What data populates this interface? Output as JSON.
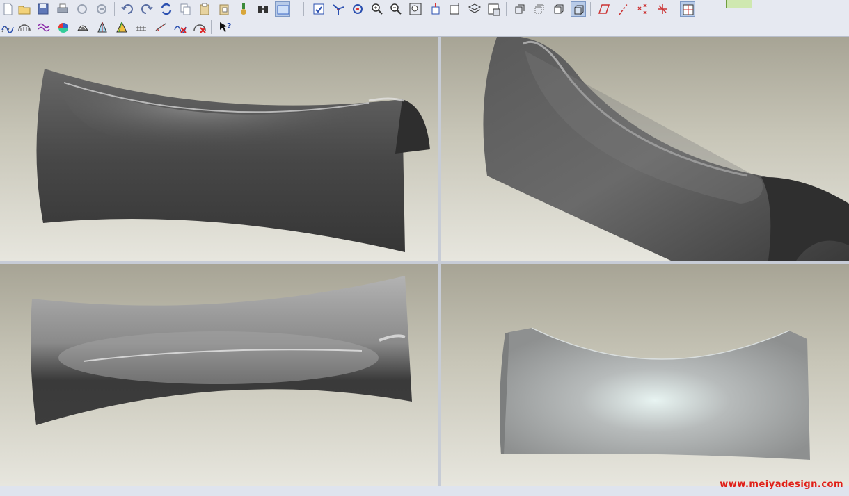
{
  "toolbar_top": {
    "tools": [
      {
        "name": "new-file-icon",
        "active": false
      },
      {
        "name": "open-folder-icon",
        "active": false
      },
      {
        "name": "save-icon",
        "active": false
      },
      {
        "name": "print-icon",
        "active": false
      },
      {
        "name": "send-mail-icon",
        "active": false
      },
      {
        "name": "send-link-icon",
        "active": false
      },
      {
        "name": "undo-icon",
        "active": false
      },
      {
        "name": "redo-icon",
        "active": false
      },
      {
        "name": "regenerate-icon",
        "active": false
      },
      {
        "name": "copy-icon",
        "active": false
      },
      {
        "name": "paste-icon",
        "active": false
      },
      {
        "name": "paste-special-icon",
        "active": false
      },
      {
        "name": "model-player-icon",
        "active": false
      },
      {
        "name": "find-binoculars-icon",
        "active": false
      },
      {
        "name": "select-box-icon",
        "active": true
      },
      {
        "name": "repaint-icon",
        "active": false
      },
      {
        "name": "spin-center-icon",
        "active": false
      },
      {
        "name": "orient-mode-icon",
        "active": false
      },
      {
        "name": "zoom-in-icon",
        "active": false
      },
      {
        "name": "zoom-out-icon",
        "active": false
      },
      {
        "name": "refit-icon",
        "active": false
      },
      {
        "name": "reorient-icon",
        "active": false
      },
      {
        "name": "saved-views-icon",
        "active": false
      },
      {
        "name": "layers-icon",
        "active": false
      },
      {
        "name": "view-manager-icon",
        "active": false
      },
      {
        "name": "wireframe-icon",
        "active": false
      },
      {
        "name": "hidden-line-icon",
        "active": false
      },
      {
        "name": "no-hidden-icon",
        "active": false
      },
      {
        "name": "shading-icon",
        "active": true
      },
      {
        "name": "datum-planes-icon",
        "active": false
      },
      {
        "name": "datum-axes-icon",
        "active": false
      },
      {
        "name": "datum-points-icon",
        "active": false
      },
      {
        "name": "coordinate-systems-icon",
        "active": false
      },
      {
        "name": "grid-toggle-icon",
        "active": true
      }
    ]
  },
  "toolbar_bottom": {
    "tools": [
      {
        "name": "curvature-analysis-icon"
      },
      {
        "name": "section-analysis-icon"
      },
      {
        "name": "offset-analysis-icon"
      },
      {
        "name": "shaded-curvature-icon"
      },
      {
        "name": "reflection-analysis-icon"
      },
      {
        "name": "draft-analysis-icon"
      },
      {
        "name": "slope-analysis-icon"
      },
      {
        "name": "dihedral-angle-icon"
      },
      {
        "name": "deviation-analysis-icon"
      },
      {
        "name": "delete-curve-analysis-icon"
      },
      {
        "name": "delete-all-analysis-icon"
      },
      {
        "name": "context-help-icon"
      }
    ]
  },
  "surface_color": "#4a4a4a",
  "background_top": "#a7a495",
  "background_bottom": "#e7e6de",
  "watermark": "www.meiyadesign.com"
}
